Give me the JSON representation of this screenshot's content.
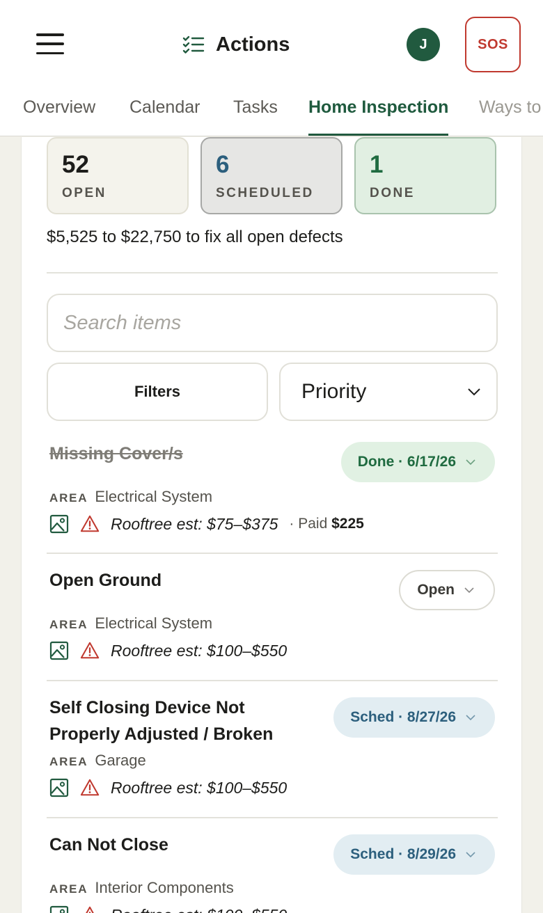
{
  "header": {
    "title": "Actions",
    "avatar_initial": "J",
    "sos_label": "SOS"
  },
  "tabs": [
    {
      "label": "Overview"
    },
    {
      "label": "Calendar"
    },
    {
      "label": "Tasks"
    },
    {
      "label": "Home Inspection"
    },
    {
      "label": "Ways to"
    }
  ],
  "stats": {
    "open": {
      "count": "52",
      "label": "OPEN"
    },
    "scheduled": {
      "count": "6",
      "label": "SCHEDULED"
    },
    "done": {
      "count": "1",
      "label": "DONE"
    }
  },
  "cost_summary": "$5,525 to $22,750 to fix all open defects",
  "search": {
    "placeholder": "Search items",
    "value": ""
  },
  "filters": {
    "button_label": "Filters",
    "sort_selected": "Priority"
  },
  "area_key": "AREA",
  "items": [
    {
      "name": "Missing Cover/s",
      "status": "Done · 6/17/26",
      "area": "Electrical System",
      "estimate": "Rooftree est: $75–$375",
      "paid_label": "· Paid",
      "paid_amount": "$225"
    },
    {
      "name": "Open Ground",
      "status": "Open",
      "area": "Electrical System",
      "estimate": "Rooftree est: $100–$550"
    },
    {
      "name": "Self Closing Device Not Properly Adjusted / Broken",
      "status": "Sched · 8/27/26",
      "area": "Garage",
      "estimate": "Rooftree est: $100–$550"
    },
    {
      "name": "Can Not Close",
      "status": "Sched · 8/29/26",
      "area": "Interior Components",
      "estimate": "Rooftree est: $100–$550"
    }
  ],
  "colors": {
    "brand_green": "#215a3f",
    "sos_red": "#c0392f",
    "sched_blue": "#2c5f7d",
    "warning_red": "#c0392f",
    "page_bg": "#f2f1ea"
  },
  "icons": [
    "menu-icon",
    "checklist-icon",
    "chevron-down-icon",
    "photo-icon",
    "warning-icon"
  ]
}
